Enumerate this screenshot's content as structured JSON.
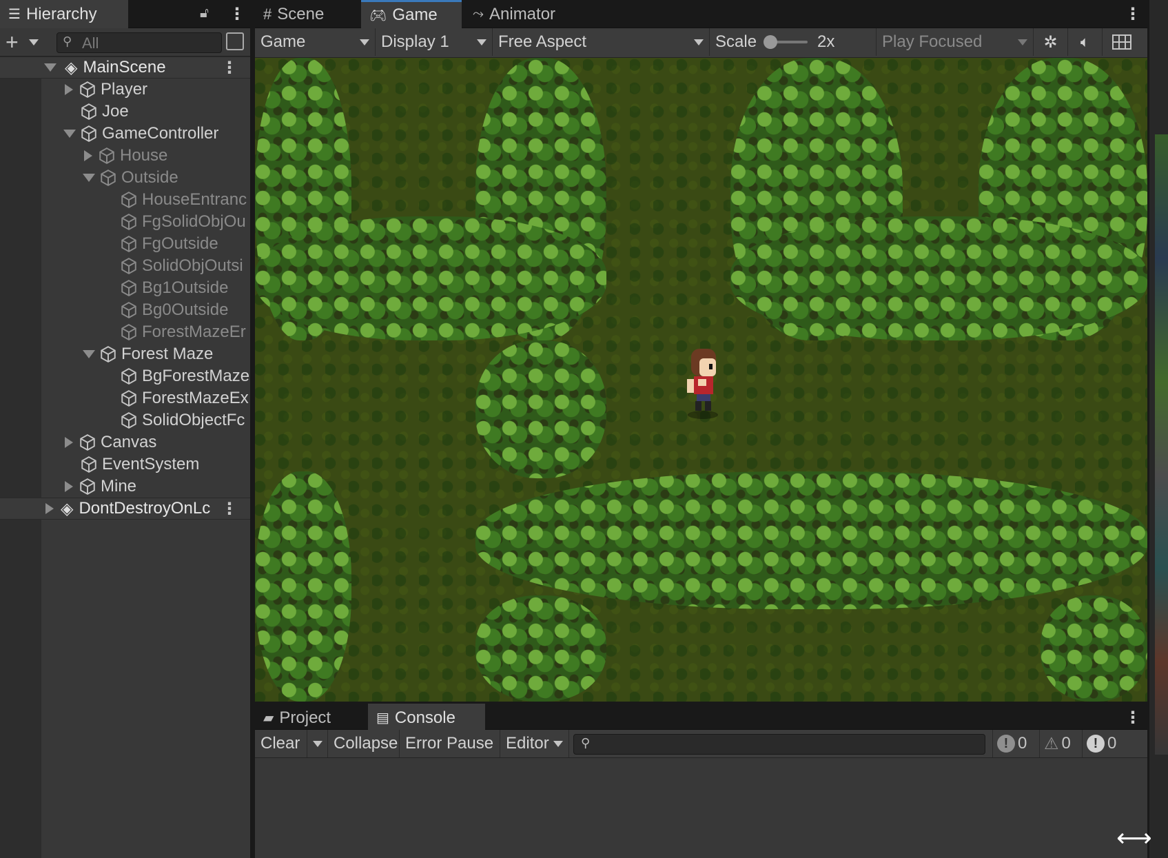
{
  "hierarchy": {
    "title": "Hierarchy",
    "search_placeholder": "All",
    "items": [
      {
        "label": "MainScene"
      },
      {
        "label": "Player"
      },
      {
        "label": "Joe"
      },
      {
        "label": "GameController"
      },
      {
        "label": "House"
      },
      {
        "label": "Outside"
      },
      {
        "label": "HouseEntranc"
      },
      {
        "label": "FgSolidObjOu"
      },
      {
        "label": "FgOutside"
      },
      {
        "label": "SolidObjOutsi"
      },
      {
        "label": "Bg1Outside"
      },
      {
        "label": "Bg0Outside"
      },
      {
        "label": "ForestMazeEr"
      },
      {
        "label": "Forest Maze"
      },
      {
        "label": "BgForestMazе"
      },
      {
        "label": "ForestMazeEх"
      },
      {
        "label": "SolidObjectFс"
      },
      {
        "label": "Canvas"
      },
      {
        "label": "EventSystem"
      },
      {
        "label": "Mine"
      },
      {
        "label": "DontDestroyOnLc"
      }
    ]
  },
  "tabs": {
    "scene": "Scene",
    "game": "Game",
    "animator": "Animator"
  },
  "game_toolbar": {
    "mode": "Game",
    "display": "Display 1",
    "aspect": "Free Aspect",
    "scale_label": "Scale",
    "scale_value": "2x",
    "play_mode": "Play Focused"
  },
  "bottom_tabs": {
    "project": "Project",
    "console": "Console"
  },
  "console": {
    "clear": "Clear",
    "collapse": "Collapse",
    "error_pause": "Error Pause",
    "editor": "Editor",
    "info_count": "0",
    "warning_count": "0",
    "error_count": "0"
  },
  "colors": {
    "accent": "#3a79bb",
    "panel": "#383838",
    "toolbar": "#3c3c3c"
  }
}
